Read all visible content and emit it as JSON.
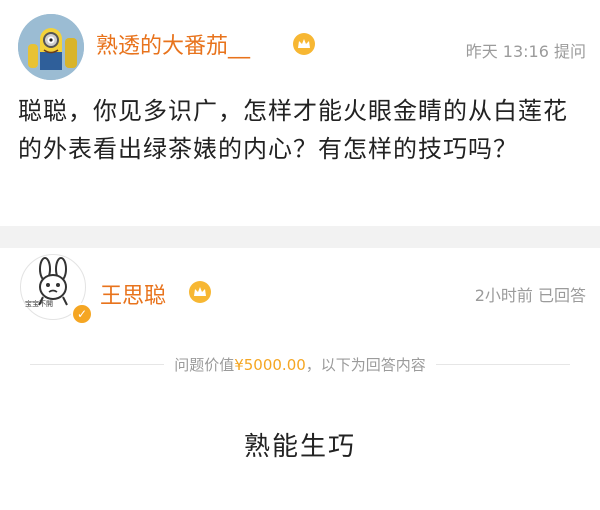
{
  "question": {
    "asker_name": "熟透的大番茄__",
    "time": "昨天 13:16",
    "action": "提问",
    "text": "聪聪，你见多识广，怎样才能火眼金睛的从白莲花的外表看出绿茶婊的内心？有怎样的技巧吗？"
  },
  "answer": {
    "answerer_name": "王思聪",
    "time": "2小时前",
    "status": "已回答",
    "avatar_caption": "宝宝不開",
    "divider": {
      "prefix": "问题价值",
      "price": "¥5000.00",
      "suffix": "，以下为回答内容"
    },
    "text": "熟能生巧"
  },
  "colors": {
    "name": "#e8731c",
    "meta": "#9b9b9b",
    "price": "#f5a623",
    "separator": "#f2f2f2"
  },
  "icons": [
    "minion-avatar",
    "crown-icon",
    "rabbit-meme-avatar",
    "verified-badge-icon"
  ]
}
